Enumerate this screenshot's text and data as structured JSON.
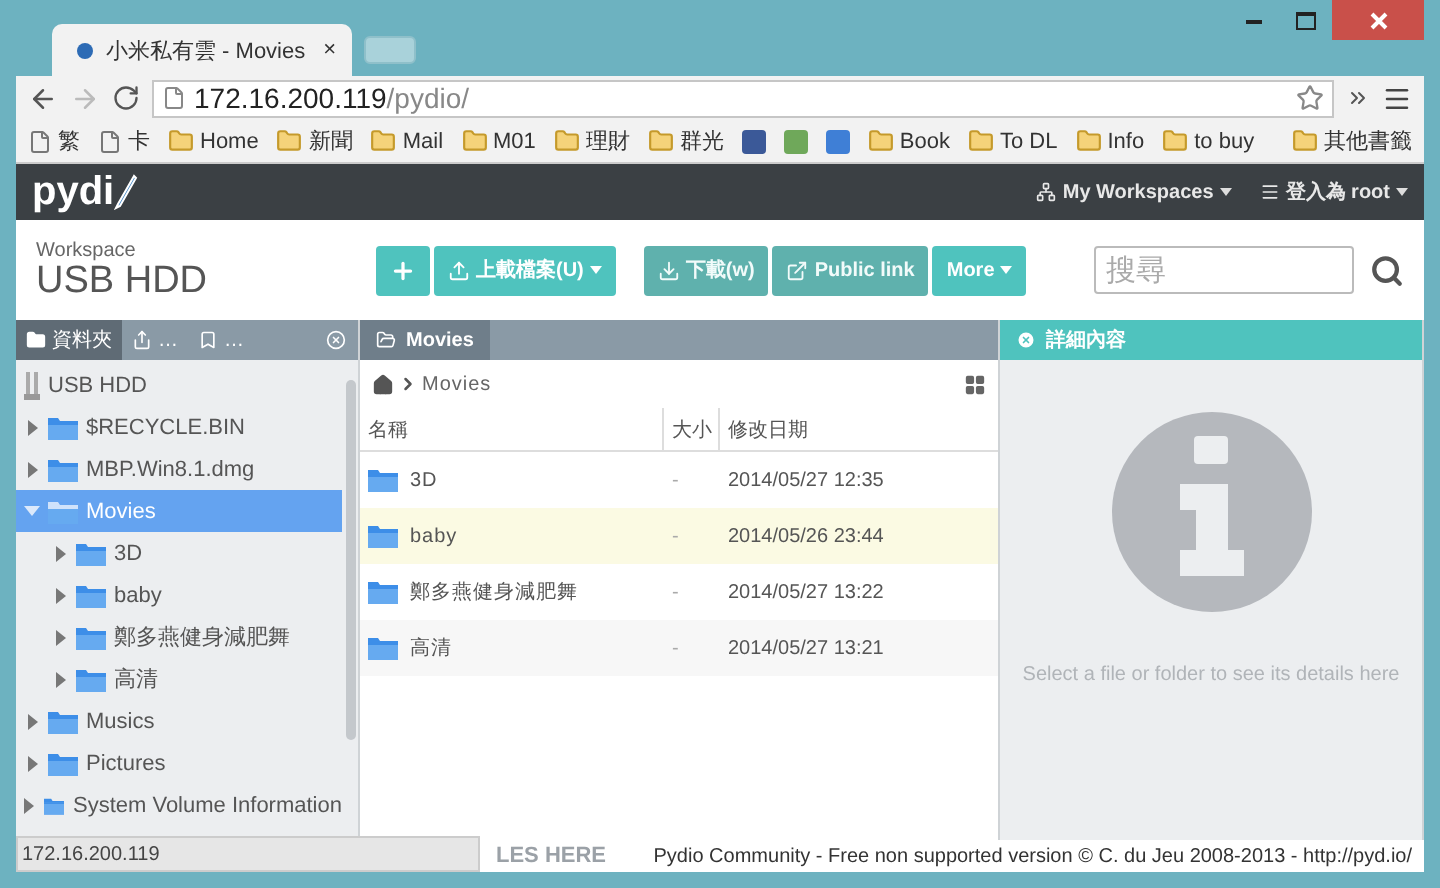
{
  "browser": {
    "tab": {
      "title": "小米私有雲 - Movies",
      "close": "×"
    },
    "url": {
      "host": "172.16.200.119",
      "path": "/pydio/"
    },
    "bookmarks": [
      {
        "kind": "page",
        "label": "繁"
      },
      {
        "kind": "page",
        "label": "卡"
      },
      {
        "kind": "folder",
        "label": "Home"
      },
      {
        "kind": "folder",
        "label": "新聞"
      },
      {
        "kind": "folder",
        "label": "Mail"
      },
      {
        "kind": "folder",
        "label": "M01"
      },
      {
        "kind": "folder",
        "label": "理財"
      },
      {
        "kind": "folder",
        "label": "群光"
      },
      {
        "kind": "app",
        "color": "#3b5998"
      },
      {
        "kind": "app",
        "color": "#6fa85a"
      },
      {
        "kind": "app",
        "color": "#3f7fd6"
      },
      {
        "kind": "folder",
        "label": "Book"
      },
      {
        "kind": "folder",
        "label": "To DL"
      },
      {
        "kind": "folder",
        "label": "Info"
      },
      {
        "kind": "folder",
        "label": "to buy"
      },
      {
        "kind": "other",
        "label": "其他書籤"
      }
    ],
    "status": "172.16.200.119"
  },
  "app": {
    "logo": "pydi",
    "nav": [
      {
        "kind": "workspaces",
        "label": "My Workspaces"
      },
      {
        "kind": "user",
        "label": "登入為 root"
      }
    ],
    "workspace": {
      "caption": "Workspace",
      "title": "USB HDD"
    },
    "actions": [
      {
        "kind": "add",
        "disabled": false,
        "menu": false
      },
      {
        "kind": "upload",
        "label": "上載檔案(U)",
        "disabled": false,
        "menu": true
      },
      {
        "kind": "download",
        "label": "下載(w)",
        "disabled": true,
        "menu": false
      },
      {
        "kind": "share",
        "label": "Public link",
        "disabled": true,
        "menu": false
      },
      {
        "kind": "more",
        "label": "More",
        "disabled": false,
        "menu": true
      }
    ],
    "search": {
      "placeholder": "搜尋"
    },
    "left_tabs": [
      {
        "kind": "folders",
        "label": "資料夾",
        "selected": true
      },
      {
        "kind": "shared",
        "label": "…",
        "selected": false
      },
      {
        "kind": "bookmarks",
        "label": "…",
        "selected": false
      }
    ],
    "tree": [
      {
        "kind": "root",
        "label": "USB HDD",
        "selected": false
      },
      {
        "kind": "folder",
        "label": "$RECYCLE.BIN",
        "selected": false,
        "expanded": false
      },
      {
        "kind": "folder",
        "label": "MBP.Win8.1.dmg",
        "selected": false,
        "expanded": false
      },
      {
        "kind": "folder",
        "label": "Movies",
        "selected": true,
        "expanded": true,
        "children": [
          {
            "kind": "folder",
            "label": "3D",
            "selected": false,
            "expanded": false
          },
          {
            "kind": "folder",
            "label": "baby",
            "selected": false,
            "expanded": false
          },
          {
            "kind": "folder",
            "label": "鄭多燕健身減肥舞",
            "selected": false,
            "expanded": false
          },
          {
            "kind": "folder",
            "label": "高清",
            "selected": false,
            "expanded": false
          }
        ]
      },
      {
        "kind": "folder",
        "label": "Musics",
        "selected": false,
        "expanded": false
      },
      {
        "kind": "folder",
        "label": "Pictures",
        "selected": false,
        "expanded": false
      },
      {
        "kind": "folder",
        "label": "System Volume Information",
        "selected": false,
        "expanded": false
      }
    ],
    "list": {
      "tab": "Movies",
      "breadcrumb": "Movies",
      "columns": [
        "名稱",
        "大小",
        "修改日期"
      ],
      "rows": [
        {
          "name": "3D",
          "size": "-",
          "modified": "2014/05/27 12:35",
          "highlighted": false
        },
        {
          "name": "baby",
          "size": "-",
          "modified": "2014/05/26 23:44",
          "highlighted": true
        },
        {
          "name": "鄭多燕健身減肥舞",
          "size": "-",
          "modified": "2014/05/27 13:22",
          "highlighted": false
        },
        {
          "name": "高清",
          "size": "-",
          "modified": "2014/05/27 13:21",
          "highlighted": false
        }
      ]
    },
    "details": {
      "title": "詳細內容",
      "empty": "Select a file or folder to see its details here"
    },
    "footer": {
      "drop_hint": "LES HERE",
      "text": "Pydio Community - Free non supported version © C. du Jeu 2008-2013 - http://pyd.io/"
    }
  }
}
